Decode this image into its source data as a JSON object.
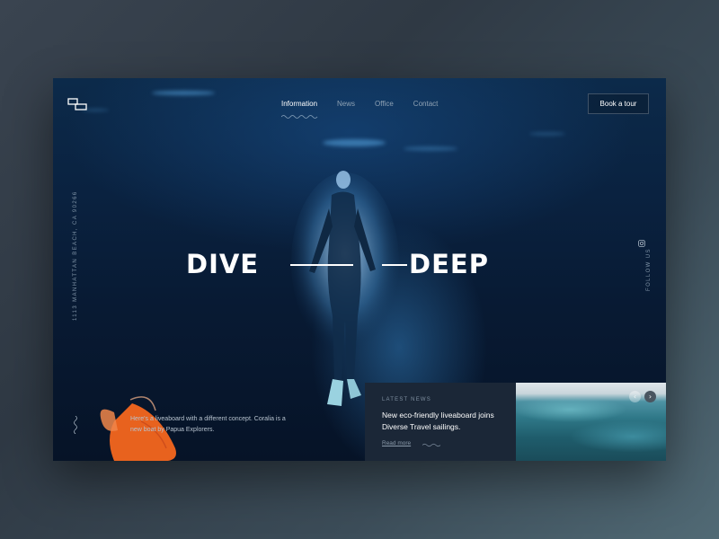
{
  "header": {
    "logo_icon": "logo-mark-icon",
    "nav": [
      {
        "label": "Information",
        "active": true
      },
      {
        "label": "News",
        "active": false
      },
      {
        "label": "Office",
        "active": false
      },
      {
        "label": "Contact",
        "active": false
      }
    ],
    "cta_label": "Book a tour"
  },
  "hero": {
    "headline_left": "DIVE",
    "headline_right": "DEEP",
    "address": "1113 MANHATTAN BEACH, CA 90266",
    "follow_label": "FOLLOW US",
    "social_icon": "instagram-icon"
  },
  "intro": {
    "text": "Here's a liveaboard with a different concept. Coralia is a new boat by Papua Explorers."
  },
  "news": {
    "label": "LATEST NEWS",
    "title": "New eco-friendly liveaboard joins Diverse Travel sailings.",
    "link_label": "Read more"
  },
  "slider": {
    "prev_icon": "‹",
    "next_icon": "›"
  },
  "colors": {
    "ocean_dark": "#061327",
    "ocean_mid": "#0c2a4a",
    "news_card": "#1b2737",
    "fish": "#e8621e",
    "text_primary": "#ffffff",
    "text_muted": "#8fa2b4"
  }
}
